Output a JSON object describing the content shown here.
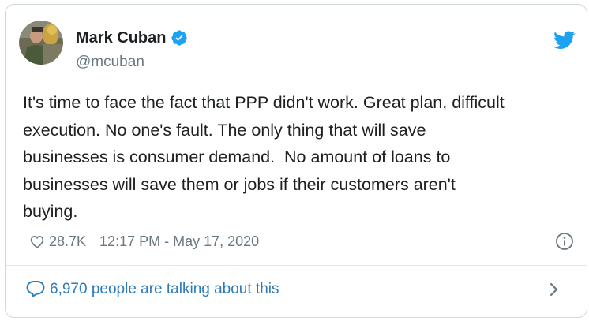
{
  "author": {
    "display_name": "Mark Cuban",
    "handle": "@mcuban",
    "verified": true,
    "avatar_icon": "profile-photo",
    "verified_icon": "verified-badge-icon"
  },
  "tweet": {
    "text": "It's time to face the fact that PPP didn't work. Great plan, difficult\nexecution. No one's fault. The only thing that will save\nbusinesses is consumer demand.  No amount of loans to\nbusinesses will save them or jobs if their customers aren't\nbuying.",
    "like_count": "28.7K",
    "timestamp": "12:17 PM - May 17, 2020"
  },
  "footer": {
    "talking_text": "6,970 people are talking about this"
  },
  "icons": {
    "brand": "twitter-bird-icon",
    "like": "heart-icon",
    "info": "info-icon",
    "comment": "comment-bubble-icon",
    "more": "chevron-right-icon"
  },
  "colors": {
    "twitter_blue": "#1da1f2",
    "link_blue": "#2b7bb9",
    "text_primary": "#1c2022",
    "text_secondary": "#697882",
    "border": "#cfd9de"
  }
}
